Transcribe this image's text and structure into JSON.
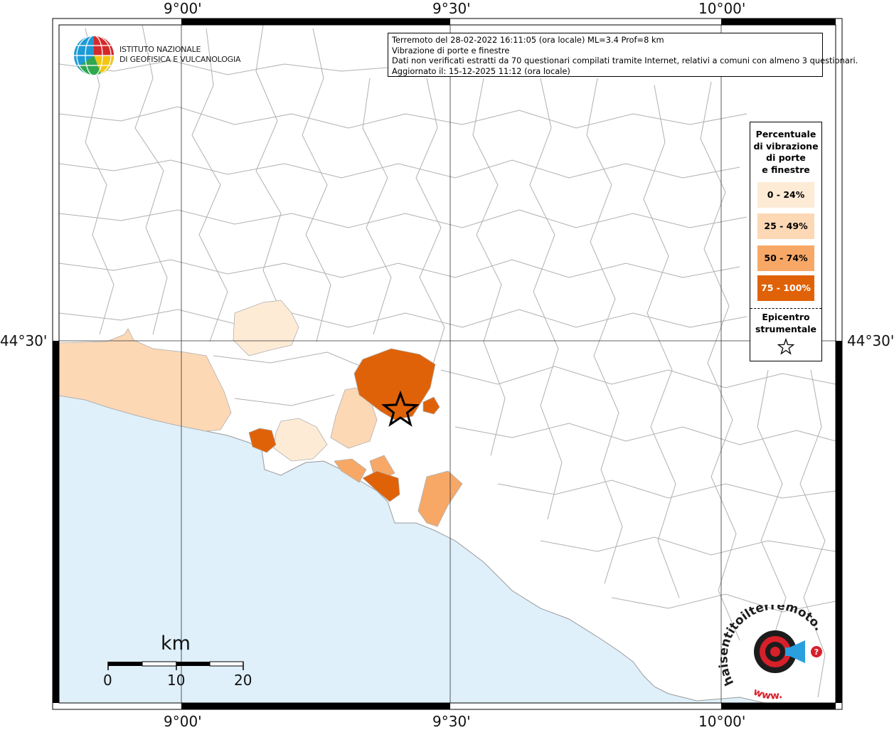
{
  "map": {
    "coords": {
      "top": [
        "9°00'",
        "9°30'",
        "10°00'"
      ],
      "bottom": [
        "9°00'",
        "9°30'",
        "10°00'"
      ],
      "left": "44°30'",
      "right": "44°30'"
    },
    "colors": {
      "sea": "#dff0fb",
      "land": "#ffffff",
      "border": "#a8a8a8",
      "class_0_24": "#fdebd6",
      "class_25_49": "#fdd8b5",
      "class_50_74": "#f7a866",
      "class_75_100": "#e06208"
    }
  },
  "logo": {
    "line1": "ISTITUTO NAZIONALE",
    "line2": "DI GEOFISICA E VULCANOLOGIA",
    "icon": "ingv-globe-icon"
  },
  "info": {
    "line1": "Terremoto del 28-02-2022 16:11:05 (ora locale) ML=3.4 Prof=8 km",
    "line2": "Vibrazione di porte e finestre",
    "line3": "Dati non verificati estratti da 70 questionari compilati tramite Internet, relativi a comuni con almeno 3 questionari.",
    "line4": "Aggiornato il: 15-12-2025 11:12 (ora locale)"
  },
  "legend": {
    "title1": "Percentuale",
    "title2": "di vibrazione",
    "title3": "di porte",
    "title4": "e finestre",
    "items": [
      {
        "label": "0 - 24%",
        "color": "#fdebd6"
      },
      {
        "label": "25 - 49%",
        "color": "#fdd8b5"
      },
      {
        "label": "50 - 74%",
        "color": "#f7a866"
      },
      {
        "label": "75 - 100%",
        "color": "#e06208"
      }
    ],
    "epicenter1": "Epicentro",
    "epicenter2": "strumentale",
    "epicenter_icon": "star-icon"
  },
  "scale": {
    "unit": "km",
    "ticks": [
      "0",
      "10",
      "20"
    ]
  },
  "brand": {
    "text": "haisentitoilterremoto.it",
    "prefix": "www.",
    "icon": "target-megaphone-icon"
  }
}
